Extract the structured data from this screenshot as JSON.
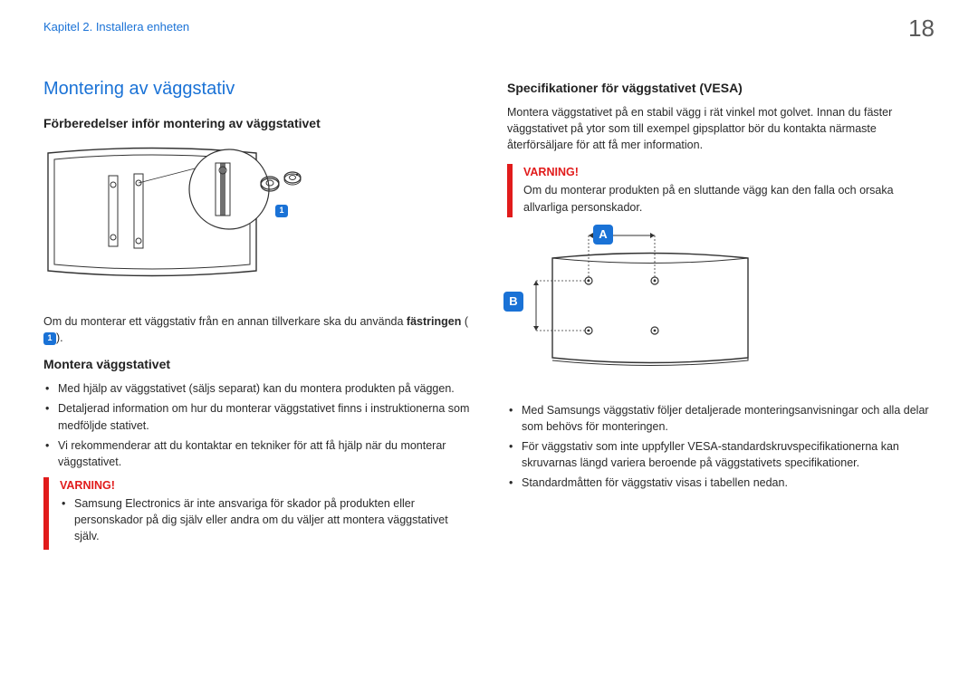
{
  "header": {
    "chapter": "Kapitel 2. Installera enheten",
    "page_number": "18"
  },
  "left": {
    "section_title": "Montering av väggstativ",
    "prep_title": "Förberedelser inför montering av väggstativet",
    "badge1": "1",
    "note_line_pre": "Om du monterar ett väggstativ från en annan tillverkare ska du använda ",
    "note_line_bold": "fästringen",
    "note_line_post": " (",
    "note_line_end": ").",
    "mount_title": "Montera väggstativet",
    "bullets": [
      "Med hjälp av väggstativet (säljs separat) kan du montera produkten på väggen.",
      "Detaljerad information om hur du monterar väggstativet finns i instruktionerna som medföljde stativet.",
      "Vi rekommenderar att du kontaktar en tekniker för att få hjälp när du monterar väggstativet."
    ],
    "warning_label": "VARNING!",
    "warning_bullet": "Samsung Electronics är inte ansvariga för skador på produkten eller personskador på dig själv eller andra om du väljer att montera väggstativet själv."
  },
  "right": {
    "spec_title": "Specifikationer för väggstativet (VESA)",
    "spec_text": "Montera väggstativet på en stabil vägg i rät vinkel mot golvet. Innan du fäster väggstativet på ytor som till exempel gipsplattor bör du kontakta närmaste återförsäljare för att få mer information.",
    "warning_label": "VARNING!",
    "warning_text": "Om du monterar produkten på en sluttande vägg kan den falla och orsaka allvarliga personskador.",
    "letter_a": "A",
    "letter_b": "B",
    "bullets": [
      "Med Samsungs väggstativ följer detaljerade monteringsanvisningar och alla delar som behövs för monteringen.",
      "För väggstativ som inte uppfyller VESA-standardskruvspecifikationerna kan skruvarnas längd variera beroende på väggstativets specifikationer.",
      "Standardmåtten för väggstativ visas i tabellen nedan."
    ]
  }
}
